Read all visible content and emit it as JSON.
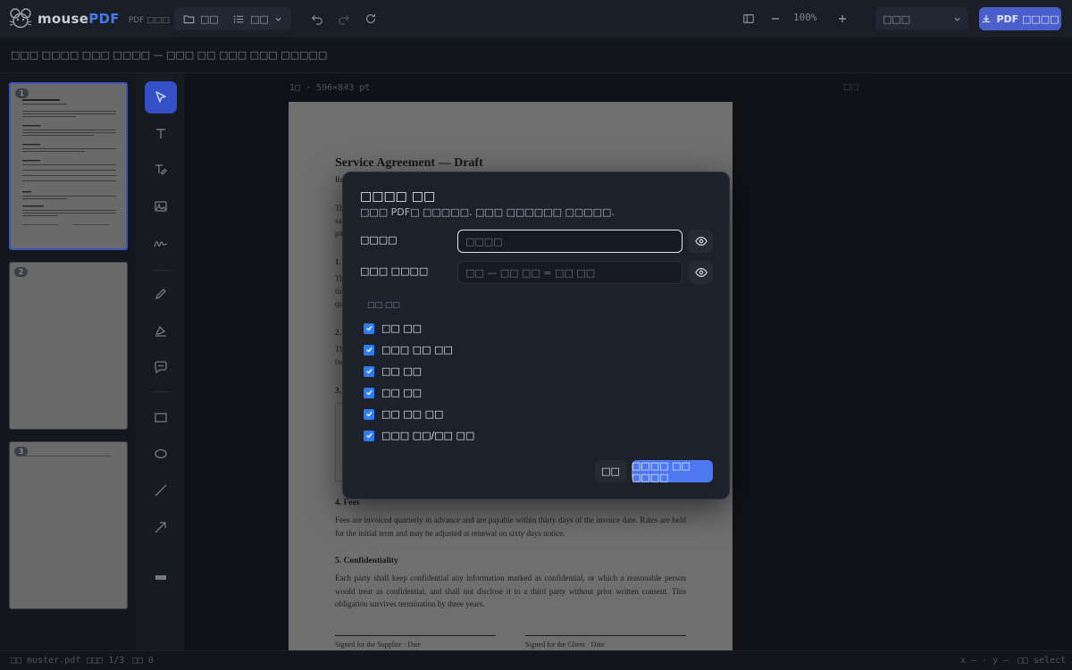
{
  "app": {
    "brand_prefix": "mouse",
    "brand_suffix": "PDF",
    "tag": "PDF □□□"
  },
  "toolbar": {
    "open_label": "□□",
    "pages_label": "□□",
    "zoom": "100%",
    "select_value": "□□□",
    "export_label": "PDF □□□□"
  },
  "subbar": {
    "text": "□□□ □□□□ □□□ □□□□ — □□□ □□ □□□ □□□ □□□□□"
  },
  "thumbnails": [
    {
      "num": "1"
    },
    {
      "num": "2"
    },
    {
      "num": "3"
    }
  ],
  "canvas": {
    "page_label": "1□ · 596×843 pt",
    "corner": "□□"
  },
  "document": {
    "title": "Service Agreement — Draft",
    "lines": [
      "Re",
      "Th",
      "sa",
      "pa",
      "1.",
      "Th",
      "tir",
      "qu",
      "2.",
      "Th",
      "tw",
      "3."
    ],
    "sec4_heading": "4. Fees",
    "sec4_body": "Fees are invoiced quarterly in advance and are payable within thirty days of the invoice date. Rates are held for the initial term and may be adjusted at renewal on sixty days notice.",
    "sec5_heading": "5. Confidentiality",
    "sec5_body": "Each party shall keep confidential any information marked as confidential, or which a reasonable person would treat as confidential, and shall not disclose it to a third party without prior written consent. This obligation survives termination by three years.",
    "sig_supplier": "Signed for the Supplier · Date",
    "sig_client": "Signed for the Client · Date"
  },
  "modal": {
    "title": "□□□□ □□",
    "desc": "□□□ PDF□ □□□□□. □□□ □□□□□□ □□□□□.",
    "password_label": "□□□□",
    "password_placeholder": "□□□□",
    "owner_label": "□□□ □□□□",
    "owner_placeholder": "□□ — □□ □□ = □□ □□",
    "permissions_label": "□□ □□",
    "permissions": [
      {
        "label": "□□ □□",
        "checked": true
      },
      {
        "label": "□□□ □□ □□",
        "checked": true
      },
      {
        "label": "□□ □□",
        "checked": true
      },
      {
        "label": "□□ □□",
        "checked": true
      },
      {
        "label": "□□ □□ □□",
        "checked": true
      },
      {
        "label": "□□□ □□/□□ □□",
        "checked": true
      }
    ],
    "cancel_label": "□□",
    "confirm_label": "□□□□ □□ □□□□"
  },
  "statusbar": {
    "file": "□□ muster.pdf",
    "page": "□□□ 1/3",
    "count": "□□ 0",
    "coords": "x — · y —",
    "mode": "□□ select"
  },
  "colors": {
    "accent": "#4d78f0",
    "checkbox": "#2f7df2",
    "active_tool": "#3550c6"
  }
}
